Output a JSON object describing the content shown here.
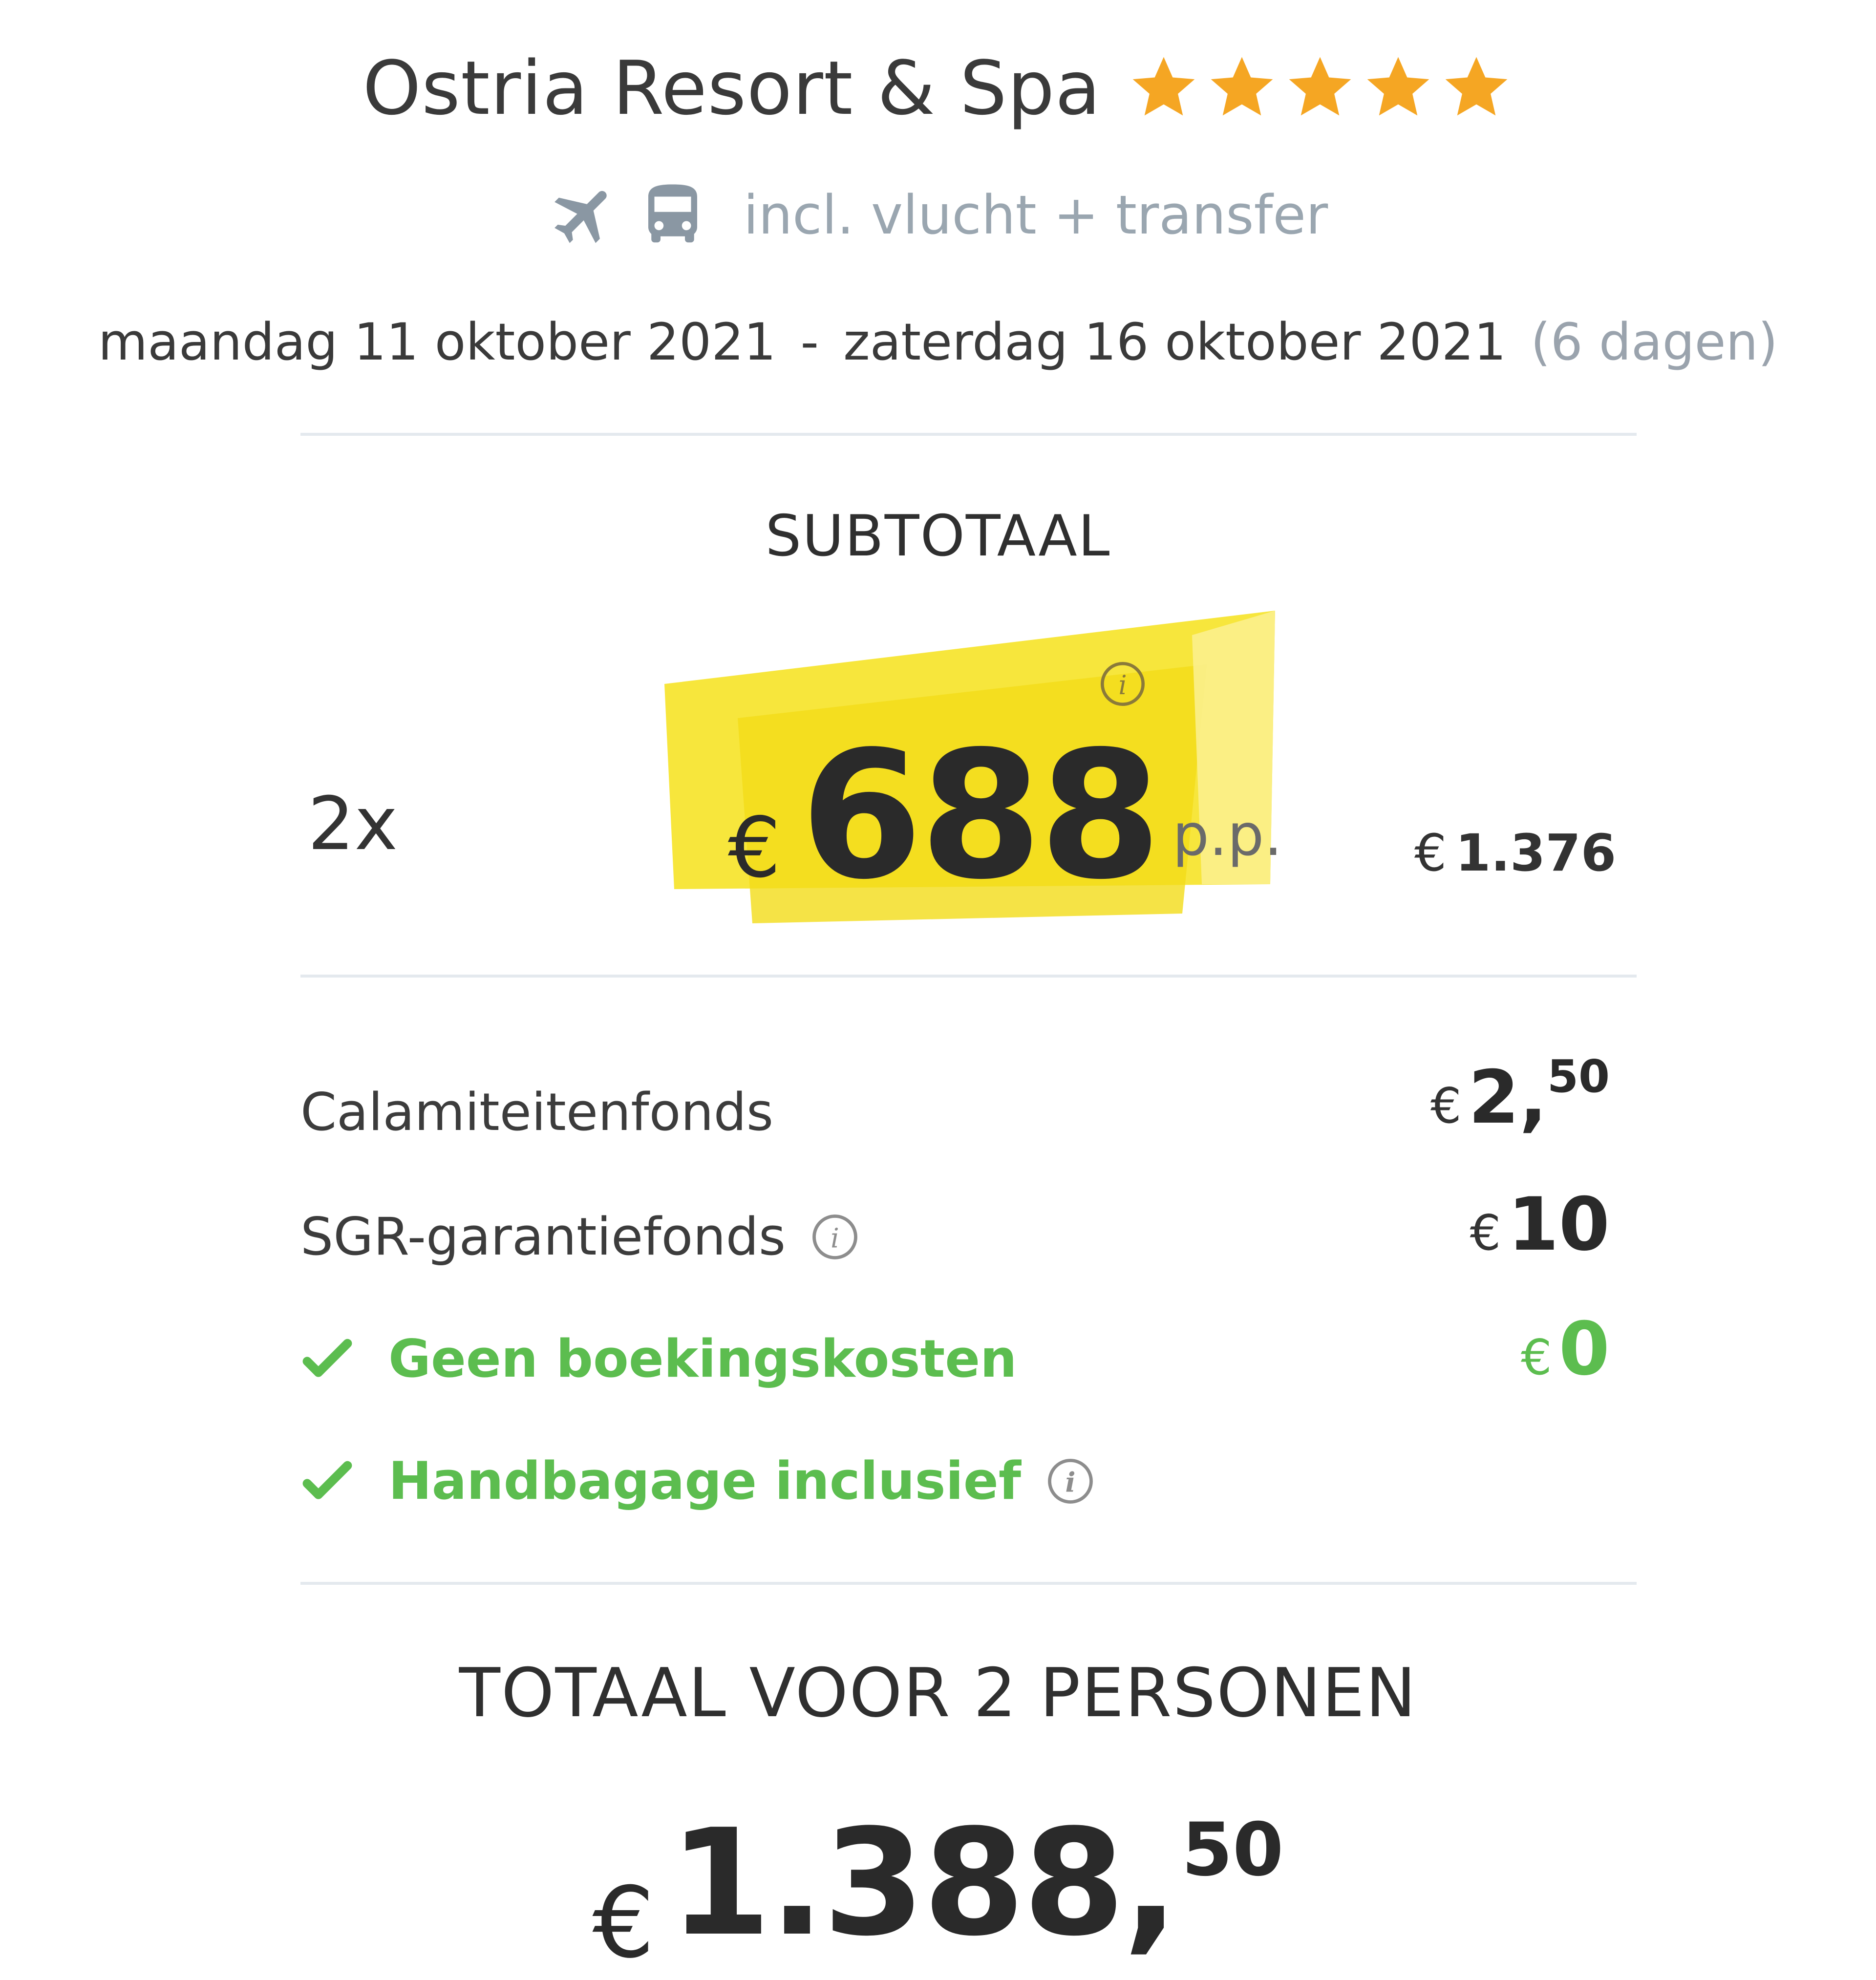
{
  "hotel": {
    "name": "Ostria Resort & Spa",
    "stars": 5,
    "star_color": "#f5a623"
  },
  "transport": {
    "icons": [
      "airplane-icon",
      "bus-icon"
    ],
    "icon_color": "#8a97a3",
    "label": "incl. vlucht + transfer"
  },
  "dates": {
    "start": "maandag 11 oktober 2021",
    "separator": "-",
    "end": "zaterdag 16 oktober 2021",
    "duration": "(6 dagen)"
  },
  "subtotal": {
    "heading": "SUBTOTAAL",
    "persons": "2x",
    "currency": "€",
    "price_pp": "688",
    "pp_suffix": "p.p.",
    "highlight_color": "#f7e531",
    "total": "1.376"
  },
  "items": [
    {
      "label": "Calamiteitenfonds",
      "currency": "€",
      "amount": "2,",
      "cents": "50"
    },
    {
      "label": "SGR-garantiefonds",
      "currency": "€",
      "amount": "10",
      "info_icon": "info-icon"
    },
    {
      "label": "Geen boekingskosten",
      "currency": "€",
      "amount": "0",
      "check_icon": "check-icon",
      "color": "#5cbd4f"
    },
    {
      "label": "Handbagage inclusief",
      "check_icon": "check-icon",
      "info_icon": "info-icon",
      "color": "#5cbd4f"
    }
  ],
  "total": {
    "heading": "TOTAAL VOOR 2 PERSONEN",
    "currency": "€",
    "amount": "1.388,",
    "cents": "50"
  }
}
